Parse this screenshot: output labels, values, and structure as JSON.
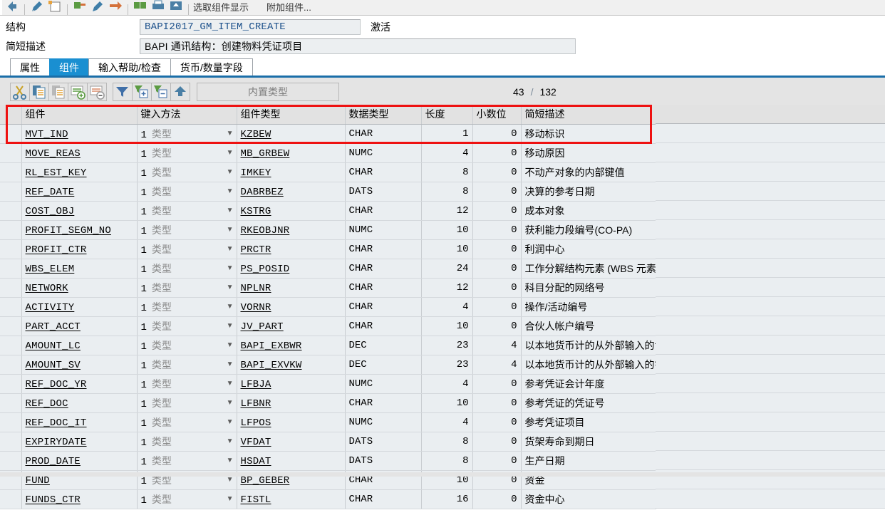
{
  "toolbar": {
    "icons": [
      "back-arrow-icon",
      "pencil-icon",
      "new-window-icon",
      "save-green-icon",
      "check-pencil-icon",
      "undo-arrow-icon",
      "two-squares-icon",
      "print-icon",
      "export-icon"
    ],
    "text_fragments": [
      "选取组件显示",
      "附加组件..."
    ]
  },
  "header": {
    "structure_label": "结构",
    "structure_value": "BAPI2017_GM_ITEM_CREATE",
    "status": "激活",
    "shortdesc_label": "简短描述",
    "shortdesc_value": "BAPI 通讯结构：创建物料凭证项目"
  },
  "tabs": [
    {
      "label": "属性",
      "active": false
    },
    {
      "label": "组件",
      "active": true
    },
    {
      "label": "输入帮助/检查",
      "active": false
    },
    {
      "label": "货币/数量字段",
      "active": false
    }
  ],
  "grid_toolbar": {
    "buttons": [
      "cut-icon",
      "copy-icon",
      "paste-icon",
      "insert-row-icon",
      "delete-row-icon",
      "filter-icon",
      "expand-icon",
      "collapse-icon",
      "append-icon"
    ],
    "builtin_type_label": "内置类型",
    "counter_current": "43",
    "counter_separator": "/",
    "counter_total": "132"
  },
  "table": {
    "columns": [
      "组件",
      "键入方法",
      "组件类型",
      "数据类型",
      "长度",
      "小数位",
      "简短描述"
    ],
    "keym_num": "1",
    "keym_text": "类型",
    "rows": [
      {
        "component": "MVT_IND",
        "ctype": "KZBEW",
        "dtype": "CHAR",
        "length": "1",
        "dec": "0",
        "desc": "移动标识"
      },
      {
        "component": "MOVE_REAS",
        "ctype": "MB_GRBEW",
        "dtype": "NUMC",
        "length": "4",
        "dec": "0",
        "desc": "移动原因"
      },
      {
        "component": "RL_EST_KEY",
        "ctype": "IMKEY",
        "dtype": "CHAR",
        "length": "8",
        "dec": "0",
        "desc": "不动产对象的内部键值"
      },
      {
        "component": "REF_DATE",
        "ctype": "DABRBEZ",
        "dtype": "DATS",
        "length": "8",
        "dec": "0",
        "desc": "决算的参考日期"
      },
      {
        "component": "COST_OBJ",
        "ctype": "KSTRG",
        "dtype": "CHAR",
        "length": "12",
        "dec": "0",
        "desc": "成本对象"
      },
      {
        "component": "PROFIT_SEGM_NO",
        "ctype": "RKEOBJNR",
        "dtype": "NUMC",
        "length": "10",
        "dec": "0",
        "desc": "获利能力段编号(CO-PA)"
      },
      {
        "component": "PROFIT_CTR",
        "ctype": "PRCTR",
        "dtype": "CHAR",
        "length": "10",
        "dec": "0",
        "desc": "利润中心"
      },
      {
        "component": "WBS_ELEM",
        "ctype": "PS_POSID",
        "dtype": "CHAR",
        "length": "24",
        "dec": "0",
        "desc": "工作分解结构元素 (WBS 元素)"
      },
      {
        "component": "NETWORK",
        "ctype": "NPLNR",
        "dtype": "CHAR",
        "length": "12",
        "dec": "0",
        "desc": "科目分配的网络号"
      },
      {
        "component": "ACTIVITY",
        "ctype": "VORNR",
        "dtype": "CHAR",
        "length": "4",
        "dec": "0",
        "desc": "操作/活动编号"
      },
      {
        "component": "PART_ACCT",
        "ctype": "JV_PART",
        "dtype": "CHAR",
        "length": "10",
        "dec": "0",
        "desc": "合伙人帐户编号"
      },
      {
        "component": "AMOUNT_LC",
        "ctype": "BAPI_EXBWR",
        "dtype": "DEC",
        "length": "23",
        "dec": "4",
        "desc": "以本地货币计的从外部输入的记帐金额"
      },
      {
        "component": "AMOUNT_SV",
        "ctype": "BAPI_EXVKW",
        "dtype": "DEC",
        "length": "23",
        "dec": "4",
        "desc": "以本地货币计的从外部输入的销售价值"
      },
      {
        "component": "REF_DOC_YR",
        "ctype": "LFBJA",
        "dtype": "NUMC",
        "length": "4",
        "dec": "0",
        "desc": "参考凭证会计年度"
      },
      {
        "component": "REF_DOC",
        "ctype": "LFBNR",
        "dtype": "CHAR",
        "length": "10",
        "dec": "0",
        "desc": "参考凭证的凭证号"
      },
      {
        "component": "REF_DOC_IT",
        "ctype": "LFPOS",
        "dtype": "NUMC",
        "length": "4",
        "dec": "0",
        "desc": "参考凭证项目"
      },
      {
        "component": "EXPIRYDATE",
        "ctype": "VFDAT",
        "dtype": "DATS",
        "length": "8",
        "dec": "0",
        "desc": "货架寿命到期日"
      },
      {
        "component": "PROD_DATE",
        "ctype": "HSDAT",
        "dtype": "DATS",
        "length": "8",
        "dec": "0",
        "desc": "生产日期"
      },
      {
        "component": "FUND",
        "ctype": "BP_GEBER",
        "dtype": "CHAR",
        "length": "10",
        "dec": "0",
        "desc": "资金"
      },
      {
        "component": "FUNDS_CTR",
        "ctype": "FISTL",
        "dtype": "CHAR",
        "length": "16",
        "dec": "0",
        "desc": "资金中心"
      }
    ]
  },
  "annotation": {
    "color": "#ee1111",
    "label": "highlight-header-and-first-row"
  }
}
